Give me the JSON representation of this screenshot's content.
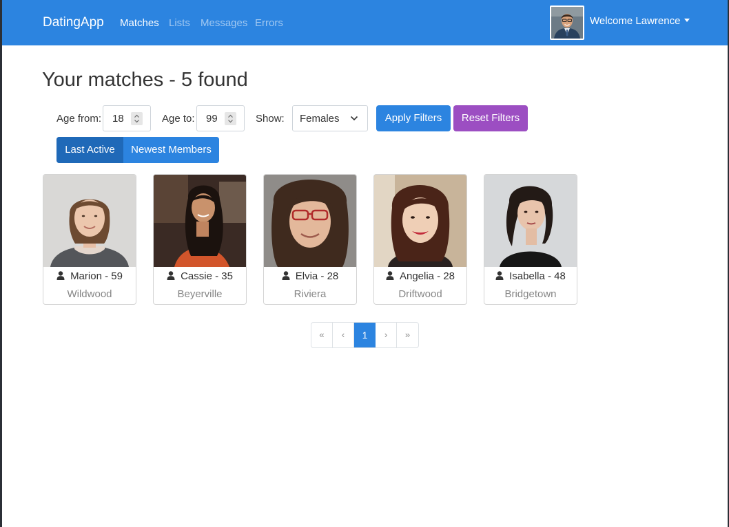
{
  "navbar": {
    "brand": "DatingApp",
    "links": [
      {
        "label": "Matches",
        "active": true
      },
      {
        "label": "Lists",
        "active": false
      },
      {
        "label": "Messages",
        "active": false
      },
      {
        "label": "Errors",
        "active": false
      }
    ],
    "user_menu_label": "Welcome Lawrence",
    "user_avatar_icon": "user-photo",
    "caret_icon": "caret-down-icon"
  },
  "page": {
    "title": "Your matches - 5 found"
  },
  "filters": {
    "age_from_label": "Age from:",
    "age_from_value": "18",
    "age_to_label": "Age to:",
    "age_to_value": "99",
    "show_label": "Show:",
    "gender_selected": "Females",
    "apply_label": "Apply Filters",
    "reset_label": "Reset Filters"
  },
  "sort": {
    "last_active_label": "Last Active",
    "newest_members_label": "Newest Members",
    "selected": "Last Active"
  },
  "members": [
    {
      "name_age": "Marion - 59",
      "city": "Wildwood"
    },
    {
      "name_age": "Cassie - 35",
      "city": "Beyerville"
    },
    {
      "name_age": "Elvia - 28",
      "city": "Riviera"
    },
    {
      "name_age": "Angelia - 28",
      "city": "Driftwood"
    },
    {
      "name_age": "Isabella - 48",
      "city": "Bridgetown"
    }
  ],
  "pagination": {
    "first": "«",
    "prev": "‹",
    "current": "1",
    "next": "›",
    "last": "»"
  },
  "colors": {
    "primary": "#2c84e0",
    "primary_active": "#1f69b8",
    "reset_button": "#9c4ec2",
    "muted_text": "#858585"
  }
}
